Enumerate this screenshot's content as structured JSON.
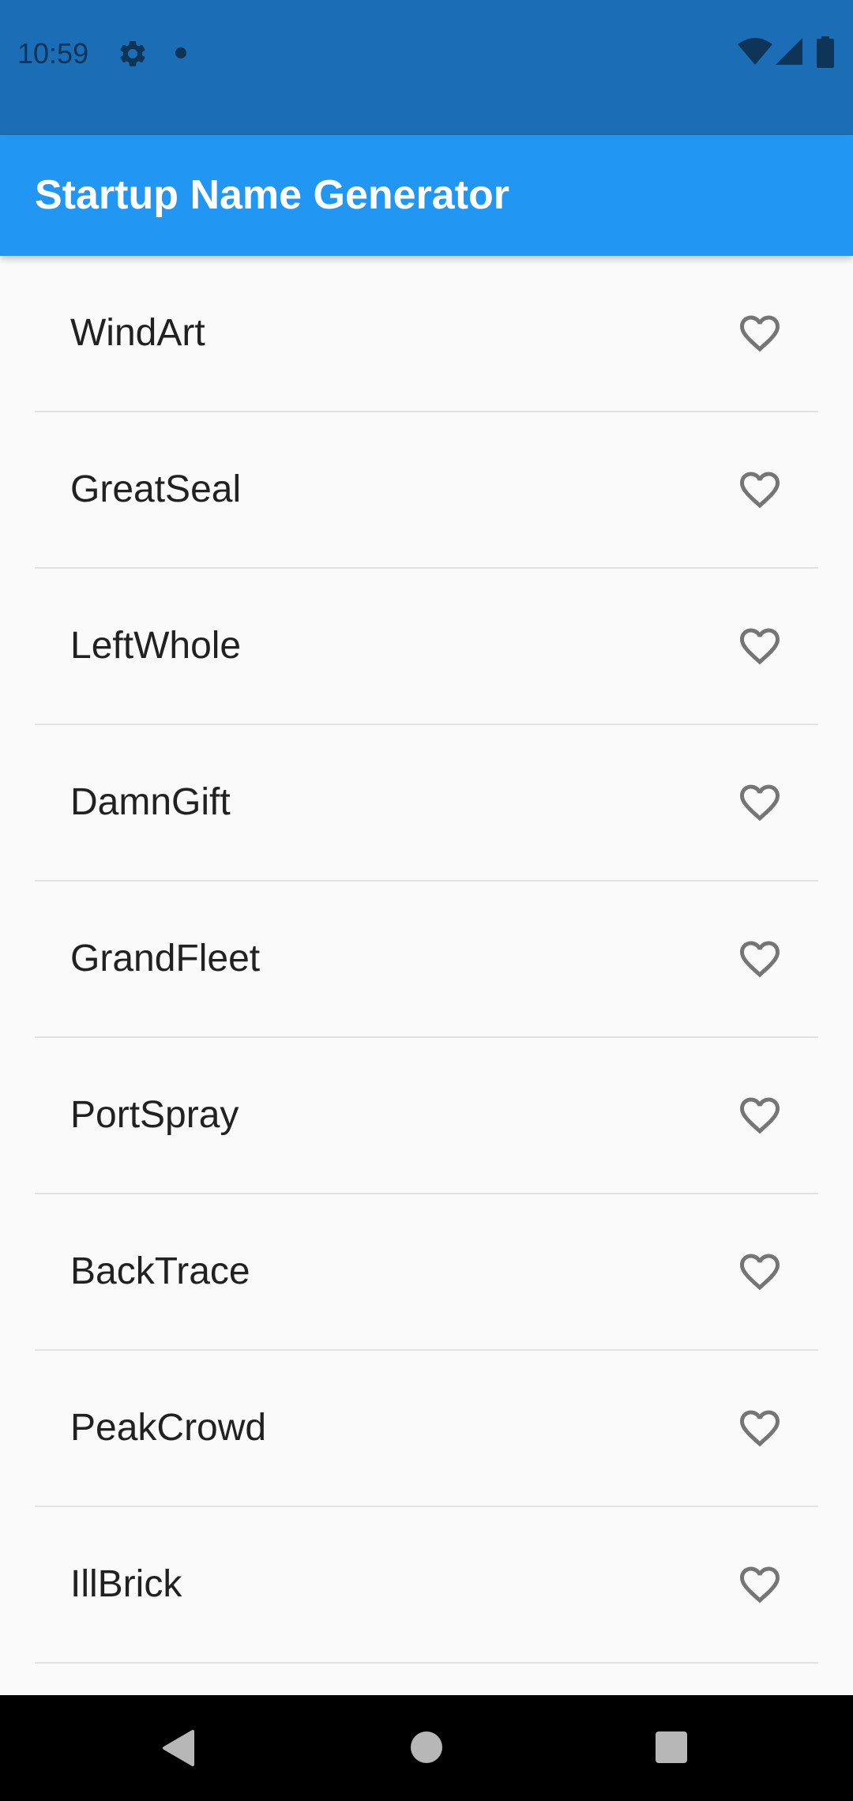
{
  "status_bar": {
    "time": "10:59",
    "icons": [
      "gear-icon",
      "notification-dot-icon",
      "wifi-icon",
      "signal-icon",
      "battery-icon"
    ]
  },
  "app_bar": {
    "title": "Startup Name Generator"
  },
  "list": {
    "items": [
      {
        "label": "WindArt",
        "icon": "heart-outline-icon",
        "favorited": false
      },
      {
        "label": "GreatSeal",
        "icon": "heart-outline-icon",
        "favorited": false
      },
      {
        "label": "LeftWhole",
        "icon": "heart-outline-icon",
        "favorited": false
      },
      {
        "label": "DamnGift",
        "icon": "heart-outline-icon",
        "favorited": false
      },
      {
        "label": "GrandFleet",
        "icon": "heart-outline-icon",
        "favorited": false
      },
      {
        "label": "PortSpray",
        "icon": "heart-outline-icon",
        "favorited": false
      },
      {
        "label": "BackTrace",
        "icon": "heart-outline-icon",
        "favorited": false
      },
      {
        "label": "PeakCrowd",
        "icon": "heart-outline-icon",
        "favorited": false
      },
      {
        "label": "IllBrick",
        "icon": "heart-outline-icon",
        "favorited": false
      }
    ]
  },
  "nav_bar": {
    "buttons": [
      "back-icon",
      "home-icon",
      "recents-icon"
    ]
  },
  "colors": {
    "status_bar": "#1b6eb5",
    "app_bar": "#2196f3",
    "background": "#fafafa",
    "heart_outline": "#757575",
    "divider": "#e3e3e3"
  }
}
